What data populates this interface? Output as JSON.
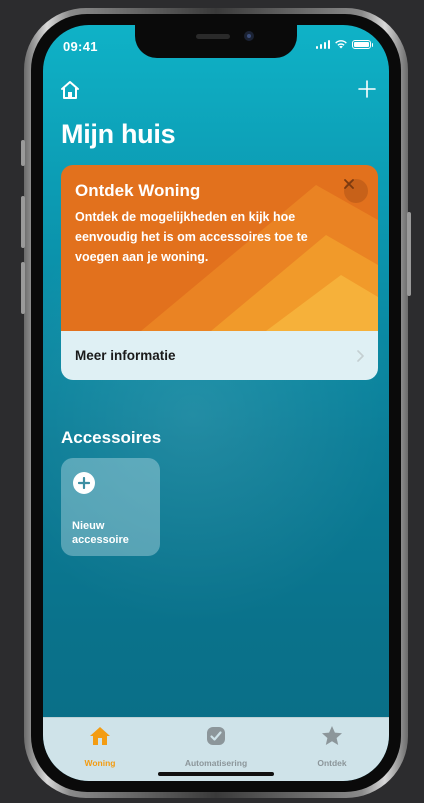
{
  "status_bar": {
    "time": "09:41"
  },
  "header": {
    "home_icon": "house-icon",
    "add_icon": "plus-icon",
    "title": "Mijn huis"
  },
  "discover_card": {
    "title": "Ontdek Woning",
    "text": "Ontdek de mogelijkheden en kijk hoe eenvoudig het is om accessoires toe te voegen aan je woning.",
    "close_icon": "close-icon",
    "link_label": "Meer informatie",
    "link_icon": "chevron-right-icon",
    "color": "#e2711d"
  },
  "accessories": {
    "section_title": "Accessoires",
    "add_tile_label": "Nieuw accessoire",
    "add_icon": "plus-circle-icon"
  },
  "tab_bar": {
    "tabs": [
      {
        "label": "Woning",
        "icon": "house-icon",
        "active": true
      },
      {
        "label": "Automatisering",
        "icon": "clock-check-icon",
        "active": false
      },
      {
        "label": "Ontdek",
        "icon": "star-icon",
        "active": false
      }
    ],
    "active_color": "#f39c12",
    "inactive_color": "#8c969a"
  },
  "colors": {
    "background_top": "#0fb2c7",
    "background_bottom": "#0a6d86"
  }
}
